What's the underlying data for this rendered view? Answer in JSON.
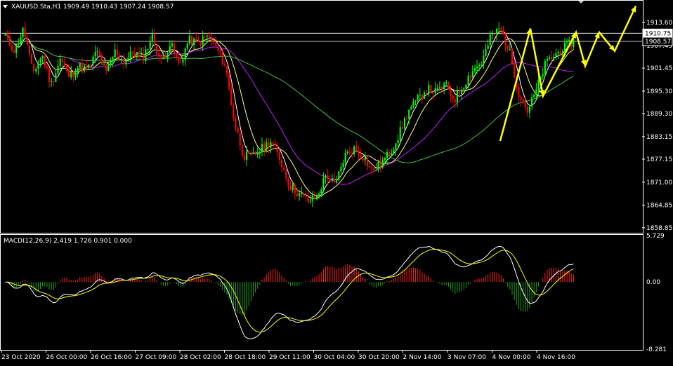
{
  "chart_window": {
    "symbol_line": "XAUUSD.Sta,H1  1909.49 1910.43 1907.24 1908.57",
    "macd_label": "MACD(12,26,9) 2.419 1.726 0.901 0.000",
    "header_arrow_icon": "triangle-down-icon",
    "corner_icon": "chart-corner-marker-icon"
  },
  "chart_data": [
    {
      "type": "candlestick",
      "title": "XAUUSD.Sta,H1",
      "ohlc_current": {
        "open": 1909.49,
        "high": 1910.43,
        "low": 1907.24,
        "close": 1908.57
      },
      "y_ticks": [
        "1913.60",
        "1907.45",
        "1901.45",
        "1895.30",
        "1889.30",
        "1883.15",
        "1877.15",
        "1871.00",
        "1864.85",
        "1858.85"
      ],
      "ylim": [
        1857.5,
        1917.0
      ],
      "price_tags": [
        {
          "label": "1910.75",
          "value": 1910.75,
          "style": "box-white"
        },
        {
          "label": "1908.57",
          "value": 1908.57,
          "style": "box-black"
        }
      ],
      "horizontal_levels": [
        1910.75,
        1908.57
      ],
      "x_tick_labels": [
        "23 Oct 2020",
        "26 Oct 00:00",
        "26 Oct 16:00",
        "27 Oct 09:00",
        "28 Oct 02:00",
        "28 Oct 18:00",
        "29 Oct 11:00",
        "30 Oct 04:00",
        "30 Oct 20:00",
        "2 Nov 14:00",
        "3 Nov 07:00",
        "4 Nov 00:00",
        "4 Nov 16:00"
      ],
      "up_color": "#00ff00",
      "down_color": "#ff0000",
      "ma_colors": [
        "#ffffff",
        "#ffff80",
        "#c020ff",
        "#40c040"
      ],
      "ma_names": [
        "fast MA",
        "medium MA",
        "slow MA",
        "long MA"
      ],
      "price_path": [
        1910,
        1906,
        1912,
        1900,
        1905,
        1897,
        1904,
        1899,
        1902,
        1901,
        1906,
        1900,
        1906,
        1903,
        1906,
        1904,
        1910,
        1903,
        1908,
        1902,
        1909,
        1908,
        1910,
        1907,
        1902,
        1887,
        1878,
        1878,
        1880,
        1882,
        1877,
        1870,
        1868,
        1866,
        1867,
        1873,
        1870,
        1878,
        1880,
        1878,
        1874,
        1876,
        1879,
        1884,
        1890,
        1893,
        1896,
        1895,
        1897,
        1893,
        1897,
        1901,
        1903,
        1910,
        1912,
        1906,
        1895,
        1890,
        1896,
        1903,
        1905,
        1907,
        1908.57
      ],
      "annotation_path": [
        {
          "x": 712,
          "price": 1882
        },
        {
          "x": 755,
          "price": 1912
        },
        {
          "x": 773,
          "price": 1894
        },
        {
          "x": 820,
          "price": 1911
        },
        {
          "x": 833,
          "price": 1902
        },
        {
          "x": 853,
          "price": 1911
        },
        {
          "x": 875,
          "price": 1906
        },
        {
          "x": 905,
          "price": 1918
        }
      ],
      "annotation_color": "#ffff00"
    },
    {
      "type": "bar+line",
      "title": "MACD(12,26,9)",
      "values_shown": {
        "macd": 2.419,
        "signal": 1.726,
        "histogram": 0.901,
        "extra": 0.0
      },
      "y_ticks": [
        "5.729",
        "0.00",
        "-8.281"
      ],
      "ylim": [
        -8.281,
        5.729
      ],
      "macd_color": "#ffffff",
      "signal_color": "#ffff00",
      "hist_pos_color": "#ff2020",
      "hist_neg_color": "#20a020"
    }
  ]
}
